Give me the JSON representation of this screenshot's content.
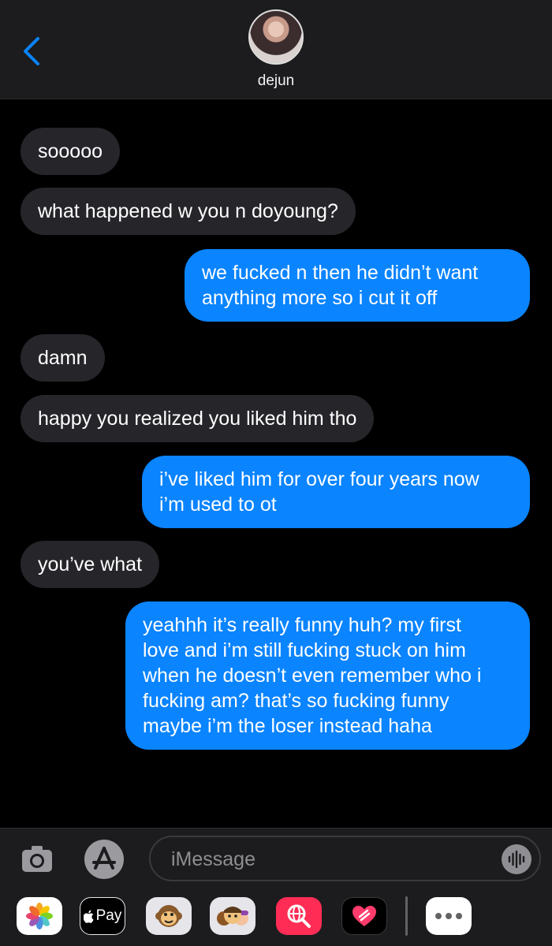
{
  "header": {
    "contact_name": "dejun",
    "back_icon": "chevron-left-icon"
  },
  "messages": [
    {
      "direction": "incoming",
      "lines": [
        "sooooo"
      ]
    },
    {
      "direction": "incoming",
      "lines": [
        "what happened w you n doyoung?"
      ]
    },
    {
      "direction": "outgoing",
      "lines": [
        "we fucked n then he didn’t want",
        "anything more so i cut it off"
      ]
    },
    {
      "direction": "incoming",
      "lines": [
        "damn"
      ]
    },
    {
      "direction": "incoming",
      "lines": [
        "happy you realized you liked him tho"
      ]
    },
    {
      "direction": "outgoing",
      "lines": [
        "i’ve liked him for over four years now",
        "i’m used to ot"
      ]
    },
    {
      "direction": "incoming",
      "lines": [
        "you’ve what"
      ]
    },
    {
      "direction": "outgoing",
      "lines": [
        "yeahhh it’s really funny huh? my first",
        "love and i’m still fucking stuck on him",
        "when he doesn’t even remember who i",
        "fucking am? that’s so fucking funny",
        "maybe i’m the loser instead haha"
      ]
    }
  ],
  "input": {
    "placeholder": "iMessage"
  },
  "apps": [
    {
      "name": "photos-app-icon"
    },
    {
      "name": "apple-pay-app-icon",
      "label": "Pay"
    },
    {
      "name": "animoji-app-icon"
    },
    {
      "name": "memoji-stickers-app-icon"
    },
    {
      "name": "web-images-search-app-icon"
    },
    {
      "name": "digital-touch-app-icon"
    },
    {
      "name": "more-apps-icon"
    }
  ],
  "colors": {
    "outgoing_bubble": "#0a84ff",
    "incoming_bubble": "#26252a",
    "accent": "#0a84ff"
  }
}
